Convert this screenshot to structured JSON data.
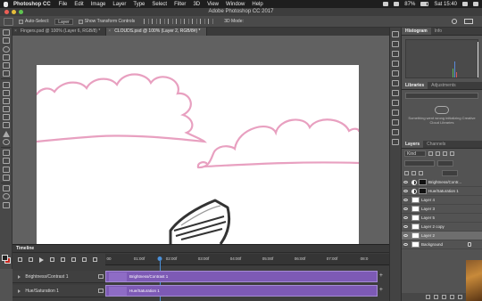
{
  "menubar": {
    "app": "Photoshop CC",
    "items": [
      "File",
      "Edit",
      "Image",
      "Layer",
      "Type",
      "Select",
      "Filter",
      "3D",
      "View",
      "Window",
      "Help"
    ],
    "battery": "87%",
    "day_time": "Sat 15:40"
  },
  "window": {
    "title": "Adobe Photoshop CC 2017"
  },
  "options": {
    "auto_select_label": "Auto-Select:",
    "auto_select_value": "Layer",
    "show_transform_label": "Show Transform Controls",
    "mode_3d_label": "3D Mode:"
  },
  "doc_tabs": [
    {
      "label": "Fingers.psd @ 100% (Layer 6, RGB/8) *",
      "active": false
    },
    {
      "label": "CLOUDS.psd @ 100% (Layer 2, RGB/8#) *",
      "active": true
    }
  ],
  "timeline": {
    "title": "Timeline",
    "ruler": [
      "00",
      "01:00f",
      "02:00f",
      "03:00f",
      "04:00f",
      "05:00f",
      "06:00f",
      "07:00f",
      "08:0"
    ],
    "tracks": [
      {
        "label": "Brightness/Contrast 1",
        "clip": "Brightness/Contrast 1"
      },
      {
        "label": "Hue/Saturation 1",
        "clip": "Hue/Saturation 1"
      }
    ]
  },
  "panels": {
    "top_tabs": [
      "Histogram",
      "Info"
    ],
    "library_tabs": [
      "Libraries",
      "Adjustments"
    ],
    "library_message": "Something went wrong initializing Creative Cloud Libraries",
    "layers_tabs": [
      "Layers",
      "Channels"
    ],
    "layer_kind": "Kind",
    "layers": [
      {
        "name": "Brightness/Contr...",
        "thumb": "adj"
      },
      {
        "name": "Hue/Saturation 1",
        "thumb": "adj"
      },
      {
        "name": "Layer 4",
        "thumb": "white"
      },
      {
        "name": "Layer 3",
        "thumb": "white"
      },
      {
        "name": "Layer 5",
        "thumb": "white"
      },
      {
        "name": "Layer 2 copy",
        "thumb": "white"
      },
      {
        "name": "Layer 2",
        "thumb": "white",
        "selected": true
      },
      {
        "name": "Background",
        "thumb": "white",
        "locked": true
      }
    ]
  },
  "colors": {
    "foreground": "#222222",
    "background": "#c8261e",
    "cloud_stroke": "#e8a0c0",
    "clip": "#7d5ab5"
  }
}
